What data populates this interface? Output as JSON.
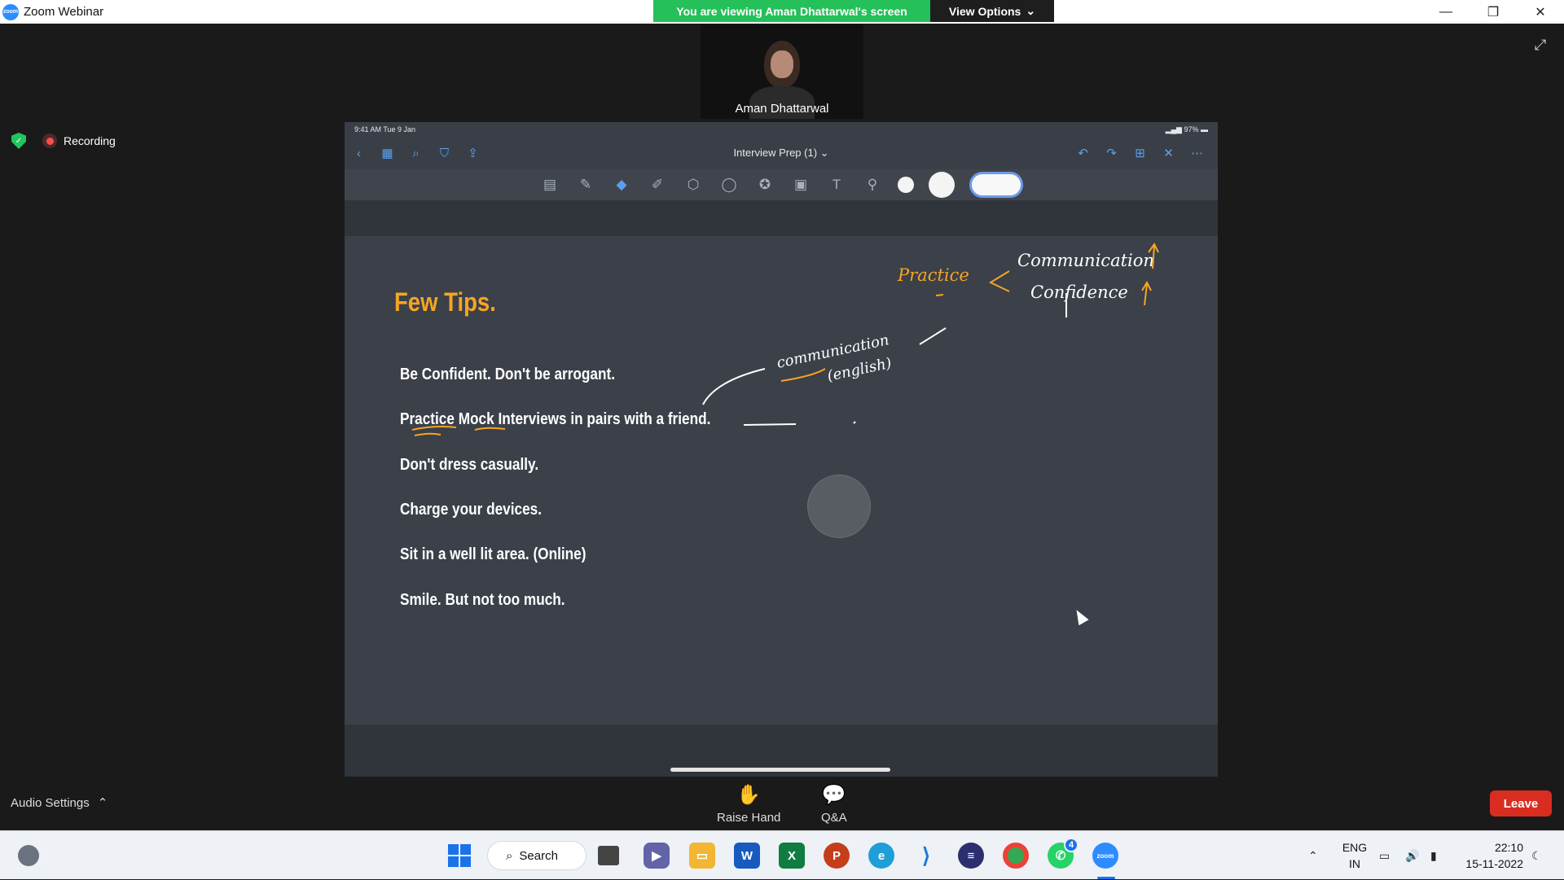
{
  "window": {
    "title": "Zoom Webinar",
    "app_icon_text": "zoom"
  },
  "share_banner": {
    "viewing_text": "You are viewing Aman Dhattarwal's screen",
    "view_options_label": "View Options"
  },
  "presenter": {
    "name": "Aman Dhattarwal"
  },
  "recording": {
    "label": "Recording"
  },
  "ipad": {
    "status_time": "9:41 AM  Tue 9 Jan",
    "status_right": "97%",
    "doc_title": "Interview Prep (1)"
  },
  "slide": {
    "title": "Few Tips.",
    "tips": [
      "Be Confident. Don't be arrogant.",
      "Practice Mock Interviews in pairs with a friend.",
      "Don't dress casually.",
      "Charge your devices.",
      "Sit in a well lit area. (Online)",
      "Smile. But not too much."
    ],
    "handwriting": {
      "practice": "Practice",
      "communication_top": "Communication",
      "confidence": "Confidence",
      "communication_mid": "communication",
      "english": "(english)"
    },
    "ink_colors": {
      "orange": "#f5a524",
      "white": "#ffffff"
    }
  },
  "controls": {
    "audio_settings": "Audio Settings",
    "raise_hand": "Raise Hand",
    "qa": "Q&A",
    "leave": "Leave"
  },
  "taskbar": {
    "search_label": "Search",
    "whatsapp_badge": "4",
    "lang_top": "ENG",
    "lang_bottom": "IN",
    "time": "22:10",
    "date": "15-11-2022"
  },
  "colors": {
    "accent_green": "#25c05a",
    "leave_red": "#d92d20",
    "zoom_blue": "#2d8cff"
  }
}
